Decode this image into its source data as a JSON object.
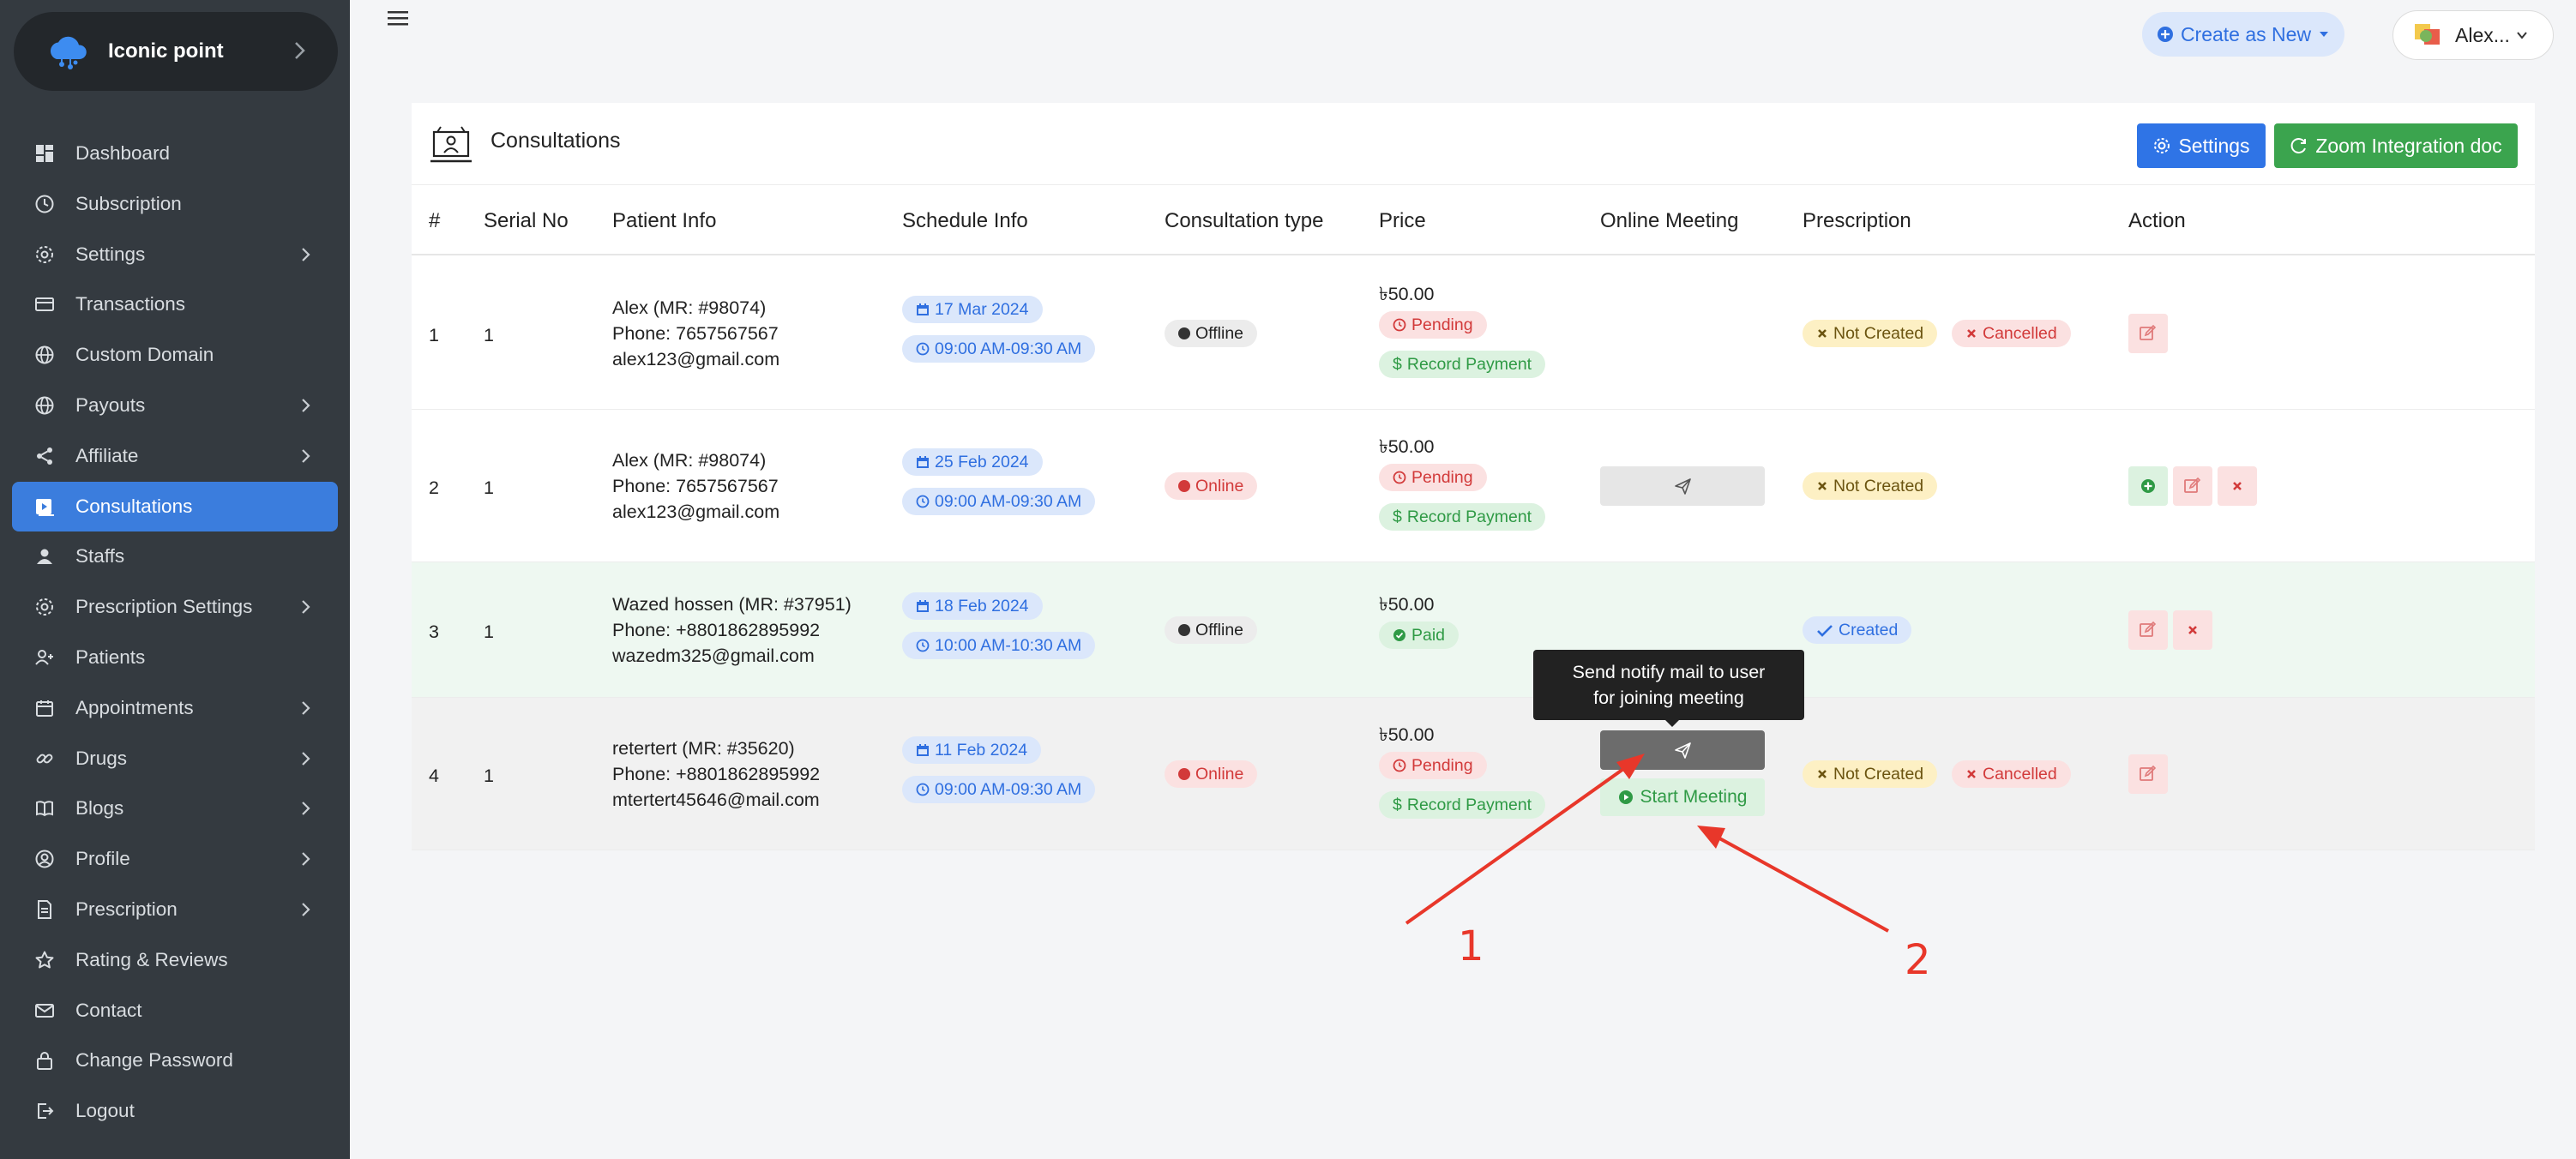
{
  "sidebar": {
    "brand": "Iconic point",
    "items": [
      {
        "label": "Dashboard",
        "icon": "dashboard-icon",
        "has_arrow": false
      },
      {
        "label": "Subscription",
        "icon": "clock-icon",
        "has_arrow": false
      },
      {
        "label": "Settings",
        "icon": "gear-icon",
        "has_arrow": true
      },
      {
        "label": "Transactions",
        "icon": "card-icon",
        "has_arrow": false
      },
      {
        "label": "Custom Domain",
        "icon": "globe-icon",
        "has_arrow": false
      },
      {
        "label": "Payouts",
        "icon": "globe-icon",
        "has_arrow": true
      },
      {
        "label": "Affiliate",
        "icon": "share-icon",
        "has_arrow": true
      },
      {
        "label": "Consultations",
        "icon": "video-icon",
        "has_arrow": false,
        "active": true
      },
      {
        "label": "Staffs",
        "icon": "user-icon",
        "has_arrow": false
      },
      {
        "label": "Prescription Settings",
        "icon": "gear-icon",
        "has_arrow": true
      },
      {
        "label": "Patients",
        "icon": "user-plus-icon",
        "has_arrow": false
      },
      {
        "label": "Appointments",
        "icon": "calendar-icon",
        "has_arrow": true
      },
      {
        "label": "Drugs",
        "icon": "link-icon",
        "has_arrow": true
      },
      {
        "label": "Blogs",
        "icon": "book-icon",
        "has_arrow": true
      },
      {
        "label": "Profile",
        "icon": "profile-icon",
        "has_arrow": true
      },
      {
        "label": "Prescription",
        "icon": "document-icon",
        "has_arrow": true
      },
      {
        "label": "Rating & Reviews",
        "icon": "star-icon",
        "has_arrow": false
      },
      {
        "label": "Contact",
        "icon": "mail-icon",
        "has_arrow": false
      },
      {
        "label": "Change Password",
        "icon": "lock-icon",
        "has_arrow": false
      },
      {
        "label": "Logout",
        "icon": "logout-icon",
        "has_arrow": false
      }
    ]
  },
  "topbar": {
    "create_label": "Create as New",
    "user_name": "Alex..."
  },
  "card": {
    "title": "Consultations",
    "settings_label": "Settings",
    "zoom_label": "Zoom Integration doc"
  },
  "table": {
    "headers": [
      "#",
      "Serial No",
      "Patient Info",
      "Schedule Info",
      "Consultation type",
      "Price",
      "Online Meeting",
      "Prescription",
      "Action"
    ],
    "rows": [
      {
        "num": "1",
        "serial": "1",
        "patient": [
          "Alex (MR: #98074)",
          "Phone: 7657567567",
          "alex123@gmail.com"
        ],
        "date": "17 Mar 2024",
        "time": "09:00 AM-09:30 AM",
        "type": "Offline",
        "price": "৳50.00",
        "status": "Pending",
        "record": "Record Payment",
        "presc": [
          "Not Created",
          "Cancelled"
        ]
      },
      {
        "num": "2",
        "serial": "1",
        "patient": [
          "Alex (MR: #98074)",
          "Phone: 7657567567",
          "alex123@gmail.com"
        ],
        "date": "25 Feb 2024",
        "time": "09:00 AM-09:30 AM",
        "type": "Online",
        "price": "৳50.00",
        "status": "Pending",
        "record": "Record Payment",
        "presc": [
          "Not Created"
        ]
      },
      {
        "num": "3",
        "serial": "1",
        "patient": [
          "Wazed hossen (MR: #37951)",
          "Phone: +8801862895992",
          "wazedm325@gmail.com"
        ],
        "date": "18 Feb 2024",
        "time": "10:00 AM-10:30 AM",
        "type": "Offline",
        "price": "৳50.00",
        "status": "Paid",
        "presc": [
          "Created"
        ]
      },
      {
        "num": "4",
        "serial": "1",
        "patient": [
          "retertert (MR: #35620)",
          "Phone: +8801862895992",
          "mtertert45646@mail.com"
        ],
        "date": "11 Feb 2024",
        "time": "09:00 AM-09:30 AM",
        "type": "Online",
        "price": "৳50.00",
        "status": "Pending",
        "record": "Record Payment",
        "start": "Start Meeting",
        "presc": [
          "Not Created",
          "Cancelled"
        ]
      }
    ]
  },
  "tooltip": {
    "line1": "Send notify mail to user",
    "line2": "for joining meeting"
  },
  "annotations": {
    "label1": "1",
    "label2": "2"
  },
  "colors": {
    "sidebar_bg": "#343a40",
    "accent": "#3b7ddd",
    "success": "#3ba44e",
    "danger": "#d23a3a",
    "annotation": "#e8372a"
  }
}
